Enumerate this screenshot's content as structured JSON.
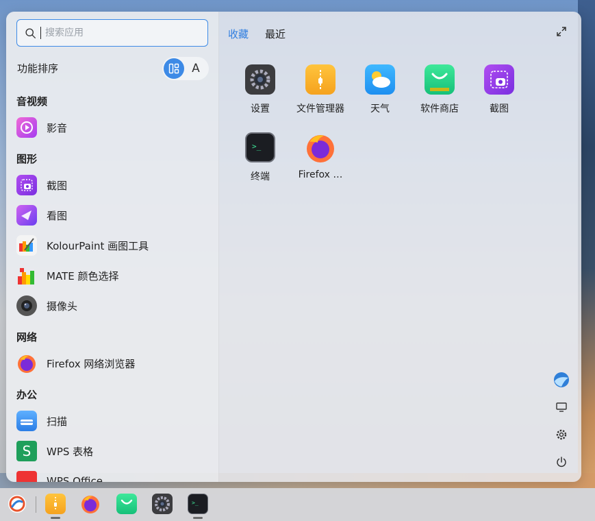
{
  "search": {
    "placeholder": "搜索应用"
  },
  "sort": {
    "label": "功能排序",
    "alpha_label": "A",
    "mode": "category"
  },
  "tabs": [
    {
      "label": "收藏",
      "active": true
    },
    {
      "label": "最近",
      "active": false
    }
  ],
  "categories": [
    {
      "title": "音视频",
      "apps": [
        {
          "label": "影音",
          "icon": "video-player-icon"
        }
      ]
    },
    {
      "title": "图形",
      "apps": [
        {
          "label": "截图",
          "icon": "screenshot-icon"
        },
        {
          "label": "看图",
          "icon": "image-viewer-icon"
        },
        {
          "label": "KolourPaint 画图工具",
          "icon": "kolourpaint-icon"
        },
        {
          "label": "MATE 颜色选择",
          "icon": "color-picker-icon"
        },
        {
          "label": "摄像头",
          "icon": "camera-icon"
        }
      ]
    },
    {
      "title": "网络",
      "apps": [
        {
          "label": "Firefox 网络浏览器",
          "icon": "firefox-icon"
        }
      ]
    },
    {
      "title": "办公",
      "apps": [
        {
          "label": "扫描",
          "icon": "scanner-icon"
        },
        {
          "label": "WPS 表格",
          "icon": "wps-spreadsheet-icon"
        },
        {
          "label": "WPS Office",
          "icon": "wps-office-icon"
        }
      ]
    }
  ],
  "favorites": [
    {
      "label": "设置",
      "icon": "settings-icon"
    },
    {
      "label": "文件管理器",
      "icon": "file-manager-icon"
    },
    {
      "label": "天气",
      "icon": "weather-icon"
    },
    {
      "label": "软件商店",
      "icon": "software-store-icon"
    },
    {
      "label": "截图",
      "icon": "screenshot-icon"
    },
    {
      "label": "终端",
      "icon": "terminal-icon"
    },
    {
      "label": "Firefox …",
      "icon": "firefox-icon"
    }
  ],
  "side_actions": [
    "user-avatar-icon",
    "monitor-icon",
    "gear-icon",
    "power-icon"
  ],
  "dock": [
    {
      "name": "launcher-icon",
      "running": false
    },
    {
      "name": "file-manager-icon",
      "running": true
    },
    {
      "name": "firefox-icon",
      "running": false
    },
    {
      "name": "software-store-icon",
      "running": false
    },
    {
      "name": "settings-icon",
      "running": false
    },
    {
      "name": "terminal-icon",
      "running": true
    }
  ],
  "colors": {
    "accent": "#3d8ae6"
  }
}
